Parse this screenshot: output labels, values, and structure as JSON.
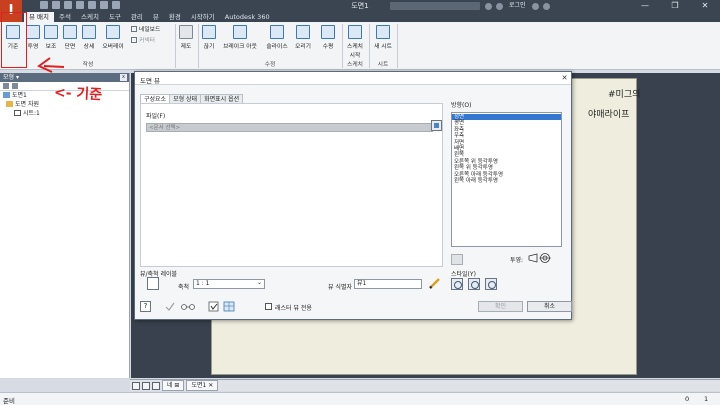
{
  "app": {
    "logo": "I",
    "document_title": "도면1",
    "login_label": "로그인",
    "window_controls": [
      "—",
      "❐",
      "✕"
    ]
  },
  "menu": {
    "tabs": [
      "뷰 배치",
      "주석",
      "스케치",
      "도구",
      "관리",
      "뷰",
      "환경",
      "시작하기",
      "Autodesk 360"
    ],
    "active_index": 0
  },
  "ribbon": {
    "buttons": {
      "base": "기준",
      "projected": "투영",
      "auxiliary": "보조",
      "section": "단면",
      "detail": "상세",
      "overlay": "오버레이",
      "nailboard": "네일보드",
      "connector": "커넥터",
      "draft": "제도",
      "break": "끊기",
      "break_out": "브레이크 아웃",
      "slice": "슬라이스",
      "crop": "오리기",
      "horizontal": "수평",
      "start_sketch": "스케치 시작",
      "new_sheet": "새 시트"
    },
    "panels": {
      "create": "작성",
      "modify": "수정",
      "sketch": "스케치",
      "sheet": "시트"
    }
  },
  "browser": {
    "title": "모형 ▾",
    "close": "x",
    "tree": [
      "도면1",
      "도면 자원",
      "시트:1"
    ]
  },
  "dialog": {
    "title": "도면 뷰",
    "close": "✕",
    "tabs": [
      "구성요소",
      "모형 상태",
      "화면표시 옵션"
    ],
    "file_label": "파일(F)",
    "file_placeholder": "<문서 선택>",
    "direction_label": "방향(O)",
    "directions": [
      "정면",
      "평면",
      "좌측",
      "우측",
      "저면",
      "배면",
      "왼쪽",
      "오른쪽 위 등각투영",
      "왼쪽 위 등각투영",
      "오른쪽 아래 등각투영",
      "왼쪽 아래 등각투영"
    ],
    "selected_direction": 0,
    "projection_label": "투영:",
    "view_scale_label": "뷰/축척 레이블",
    "scale_label": "축척",
    "scale_value": "1 : 1",
    "view_id_label": "뷰 식별자",
    "view_id_value": "뷰1",
    "style_label": "스타일(Y)",
    "help": "?",
    "raster_label": "래스터 뷰 전용",
    "ok": "확인",
    "cancel": "취소"
  },
  "sheet_tabs": {
    "items": [
      "네 ⊞",
      "도면1 ✕"
    ]
  },
  "status": {
    "text": "준비",
    "num1": "0",
    "num2": "1"
  },
  "annotations": {
    "base_note": "<- 기준",
    "blog_line1": "#미그의",
    "blog_line2": "야매라이프"
  },
  "colors": {
    "accent_red": "#e02020",
    "title_bar": "#3b4552",
    "selection": "#3377d0"
  }
}
